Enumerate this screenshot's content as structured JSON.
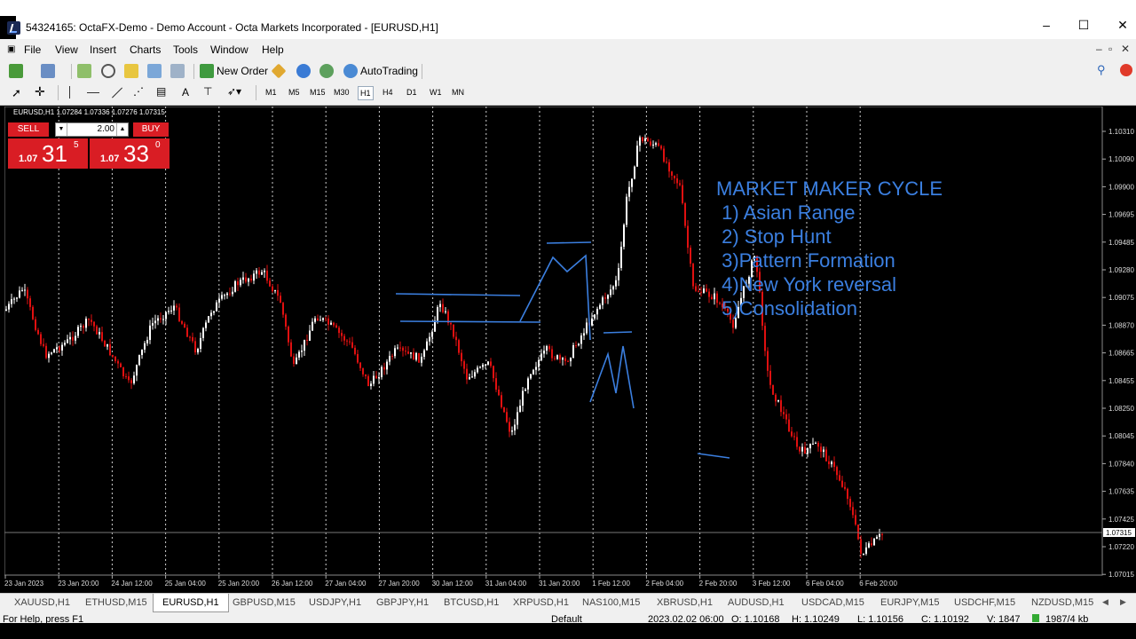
{
  "window": {
    "title": "54324165: OctaFX-Demo - Demo Account - Octa Markets Incorporated - [EURUSD,H1]",
    "minimize": "–",
    "maximize": "☐",
    "close": "✕"
  },
  "menu": {
    "items": [
      "File",
      "View",
      "Insert",
      "Charts",
      "Tools",
      "Window",
      "Help"
    ],
    "mdi_minimize": "–",
    "mdi_restore": "▫",
    "mdi_close": "✕"
  },
  "toolbar": {
    "new_order": "New Order",
    "autotrading": "AutoTrading"
  },
  "timeframes": [
    "M1",
    "M5",
    "M15",
    "M30",
    "H1",
    "H4",
    "D1",
    "W1",
    "MN"
  ],
  "selected_timeframe": "H1",
  "chart": {
    "symbol_info": "EURUSD,H1  1.07284 1.07336 1.07276 1.07315",
    "trade": {
      "sell_label": "SELL",
      "buy_label": "BUY",
      "lot": "2.00",
      "sell_prefix": "1.07",
      "sell_big": "31",
      "sell_sup": "5",
      "buy_prefix": "1.07",
      "buy_big": "33",
      "buy_sup": "0"
    },
    "price_labels": [
      "1.10310",
      "1.10090",
      "1.09900",
      "1.09695",
      "1.09485",
      "1.09280",
      "1.09075",
      "1.08870",
      "1.08665",
      "1.08455",
      "1.08250",
      "1.08045",
      "1.07840",
      "1.07635",
      "1.07425",
      "1.07220",
      "1.07015"
    ],
    "current_price": "1.07315",
    "time_labels": [
      "23 Jan 2023",
      "23 Jan 20:00",
      "24 Jan 12:00",
      "25 Jan 04:00",
      "25 Jan 20:00",
      "26 Jan 12:00",
      "27 Jan 04:00",
      "27 Jan 20:00",
      "30 Jan 12:00",
      "31 Jan 04:00",
      "31 Jan 20:00",
      "1 Feb 12:00",
      "2 Feb 04:00",
      "2 Feb 20:00",
      "3 Feb 12:00",
      "6 Feb 04:00",
      "6 Feb 20:00"
    ],
    "annotation": {
      "title": "MARKET MAKER CYCLE",
      "lines": [
        " 1) Asian Range",
        " 2) Stop Hunt",
        " 3)Pattern Formation",
        " 4)New York reversal",
        " 5)Consolidation"
      ],
      "color": "#3b7fe0"
    },
    "colors": {
      "bull": "#ffffff",
      "bear": "#e01010",
      "drawing": "#3b7fe0",
      "grid": "#d0d0d0"
    }
  },
  "tabs": [
    "XAUUSD,H1",
    "ETHUSD,M15",
    "EURUSD,H1",
    "GBPUSD,M15",
    "USDJPY,H1",
    "GBPJPY,H1",
    "BTCUSD,H1",
    "XRPUSD,H1",
    "NAS100,M15",
    "XBRUSD,H1",
    "AUDUSD,H1",
    "USDCAD,M15",
    "EURJPY,M15",
    "USDCHF,M15",
    "NZDUSD,M15"
  ],
  "active_tab": "EURUSD,H1",
  "status": {
    "help": "For Help, press F1",
    "profile": "Default",
    "datetime": "2023.02.02 06:00",
    "open": "O: 1.10168",
    "high": "H: 1.10249",
    "low": "L: 1.10156",
    "close": "C: 1.10192",
    "volume": "V: 1847",
    "traffic": "1987/4 kb"
  }
}
